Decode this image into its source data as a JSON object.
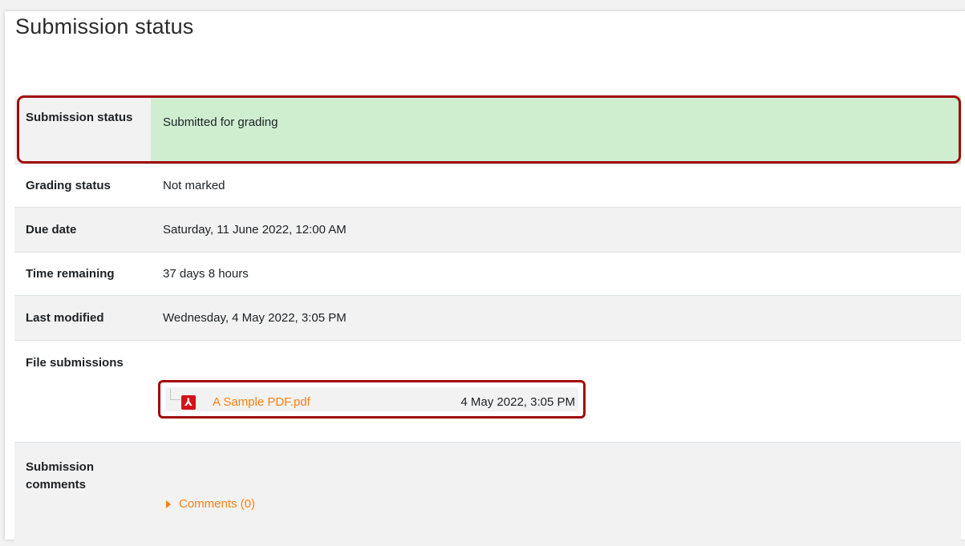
{
  "page": {
    "title": "Submission status"
  },
  "status_table": {
    "rows": [
      {
        "label": "Submission status",
        "value": "Submitted for grading"
      },
      {
        "label": "Grading status",
        "value": "Not marked"
      },
      {
        "label": "Due date",
        "value": "Saturday, 11 June 2022, 12:00 AM"
      },
      {
        "label": "Time remaining",
        "value": "37 days 8 hours"
      },
      {
        "label": "Last modified",
        "value": "Wednesday, 4 May 2022, 3:05 PM"
      },
      {
        "label": "File submissions",
        "value": ""
      },
      {
        "label": "Submission comments",
        "value": ""
      }
    ]
  },
  "file_submission": {
    "file_name": "A Sample PDF.pdf",
    "modified": "4 May 2022, 3:05 PM",
    "icon": "pdf-icon"
  },
  "comments": {
    "toggle_label": "Comments (0)"
  },
  "colors": {
    "accent_link": "#f98012",
    "success_bg": "#cfeed0",
    "highlight_border": "#a20a0a",
    "pdf_red": "#d5111a"
  }
}
